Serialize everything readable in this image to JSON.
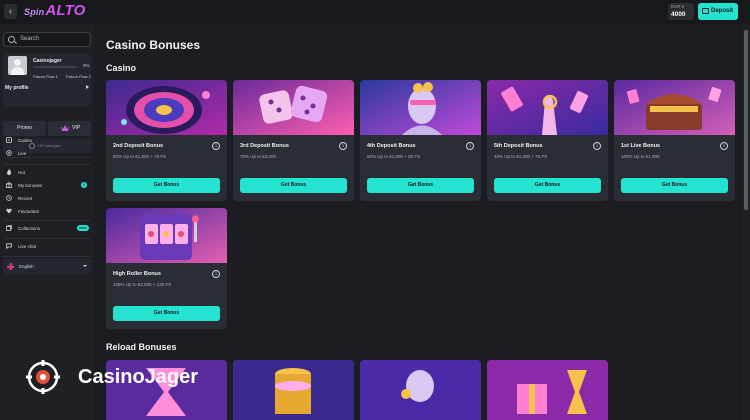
{
  "topbar": {
    "back_icon": "chevron-left-icon",
    "logo_prefix": "Spin",
    "logo_main": "ALTO",
    "balance_currency": "EUR ▾",
    "balance_amount": "4000",
    "deposit_label": "Deposit",
    "deposit_icon": "wallet-icon"
  },
  "sidebar": {
    "search_placeholder": "Search",
    "profile": {
      "username": "Casinojager",
      "progress_percent": "0%",
      "progress_fraction": 0,
      "flow_current": "Falcon Flow 1",
      "flow_next": "Falcon Flow 2",
      "my_profile_label": "My profile"
    },
    "promo_label": "Promo",
    "vip_label": "VIP",
    "vip_manager_label": "VIP manager",
    "group1": [
      {
        "label": "Casino",
        "icon": "casino-icon"
      },
      {
        "label": "Live",
        "icon": "live-icon"
      }
    ],
    "group2": [
      {
        "label": "Hot",
        "icon": "flame-icon"
      },
      {
        "label": "My bonuses",
        "icon": "gift-icon",
        "badge": "0"
      },
      {
        "label": "Recent",
        "icon": "clock-icon"
      },
      {
        "label": "Favourites",
        "icon": "heart-icon"
      }
    ],
    "collections_label": "Collections",
    "collections_badge": "New",
    "live_chat_label": "Live chat",
    "language_label": "English"
  },
  "main": {
    "page_title": "Casino Bonuses",
    "section_casino": "Casino",
    "section_reload": "Reload Bonuses",
    "button_label": "Get Bonus",
    "info_symbol": "i",
    "cards": [
      {
        "title": "2nd Deposit Bonus",
        "desc": "80% Up to €1,500 + 75 FS"
      },
      {
        "title": "3rd Deposit Bonus",
        "desc": "70% Up to €3,000"
      },
      {
        "title": "4th Deposit Bonus",
        "desc": "60% Up to €1,000 + 50 FS"
      },
      {
        "title": "5th Deposit Bonus",
        "desc": "40% Up to €1,000 + 75 FS"
      },
      {
        "title": "1st Live Bonus",
        "desc": "100% Up to €1,000"
      },
      {
        "title": "High Roller Bonus",
        "desc": "125% Up to €2,000 + 125 FS"
      }
    ]
  },
  "watermark": {
    "text": "CasinoJager"
  },
  "colors": {
    "accent": "#24e3d0",
    "brand": "#d452f0",
    "background": "#1b1d22",
    "card": "#2a2d33"
  }
}
